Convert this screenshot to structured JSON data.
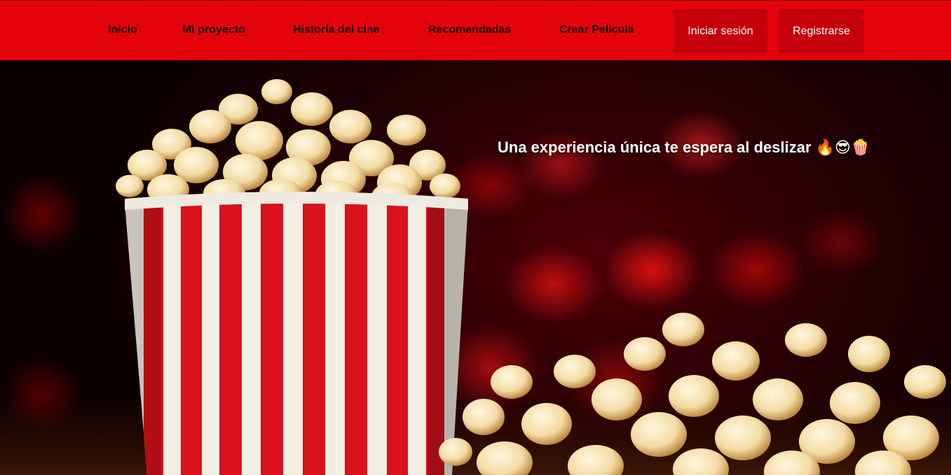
{
  "nav": {
    "links": [
      {
        "label": "Inicio"
      },
      {
        "label": "Mi proyecto"
      },
      {
        "label": "Historia del cine"
      },
      {
        "label": "Recomendadas"
      },
      {
        "label": "Crear Pelicula"
      }
    ],
    "login_label": "Iniciar sesión",
    "register_label": "Registrarse",
    "bar_color": "#e5030b",
    "button_color": "#c4000a"
  },
  "hero": {
    "caption": "Una experiencia única te espera al deslizar 🔥😎🍿",
    "image": "popcorn-bucket-cinema-image"
  }
}
